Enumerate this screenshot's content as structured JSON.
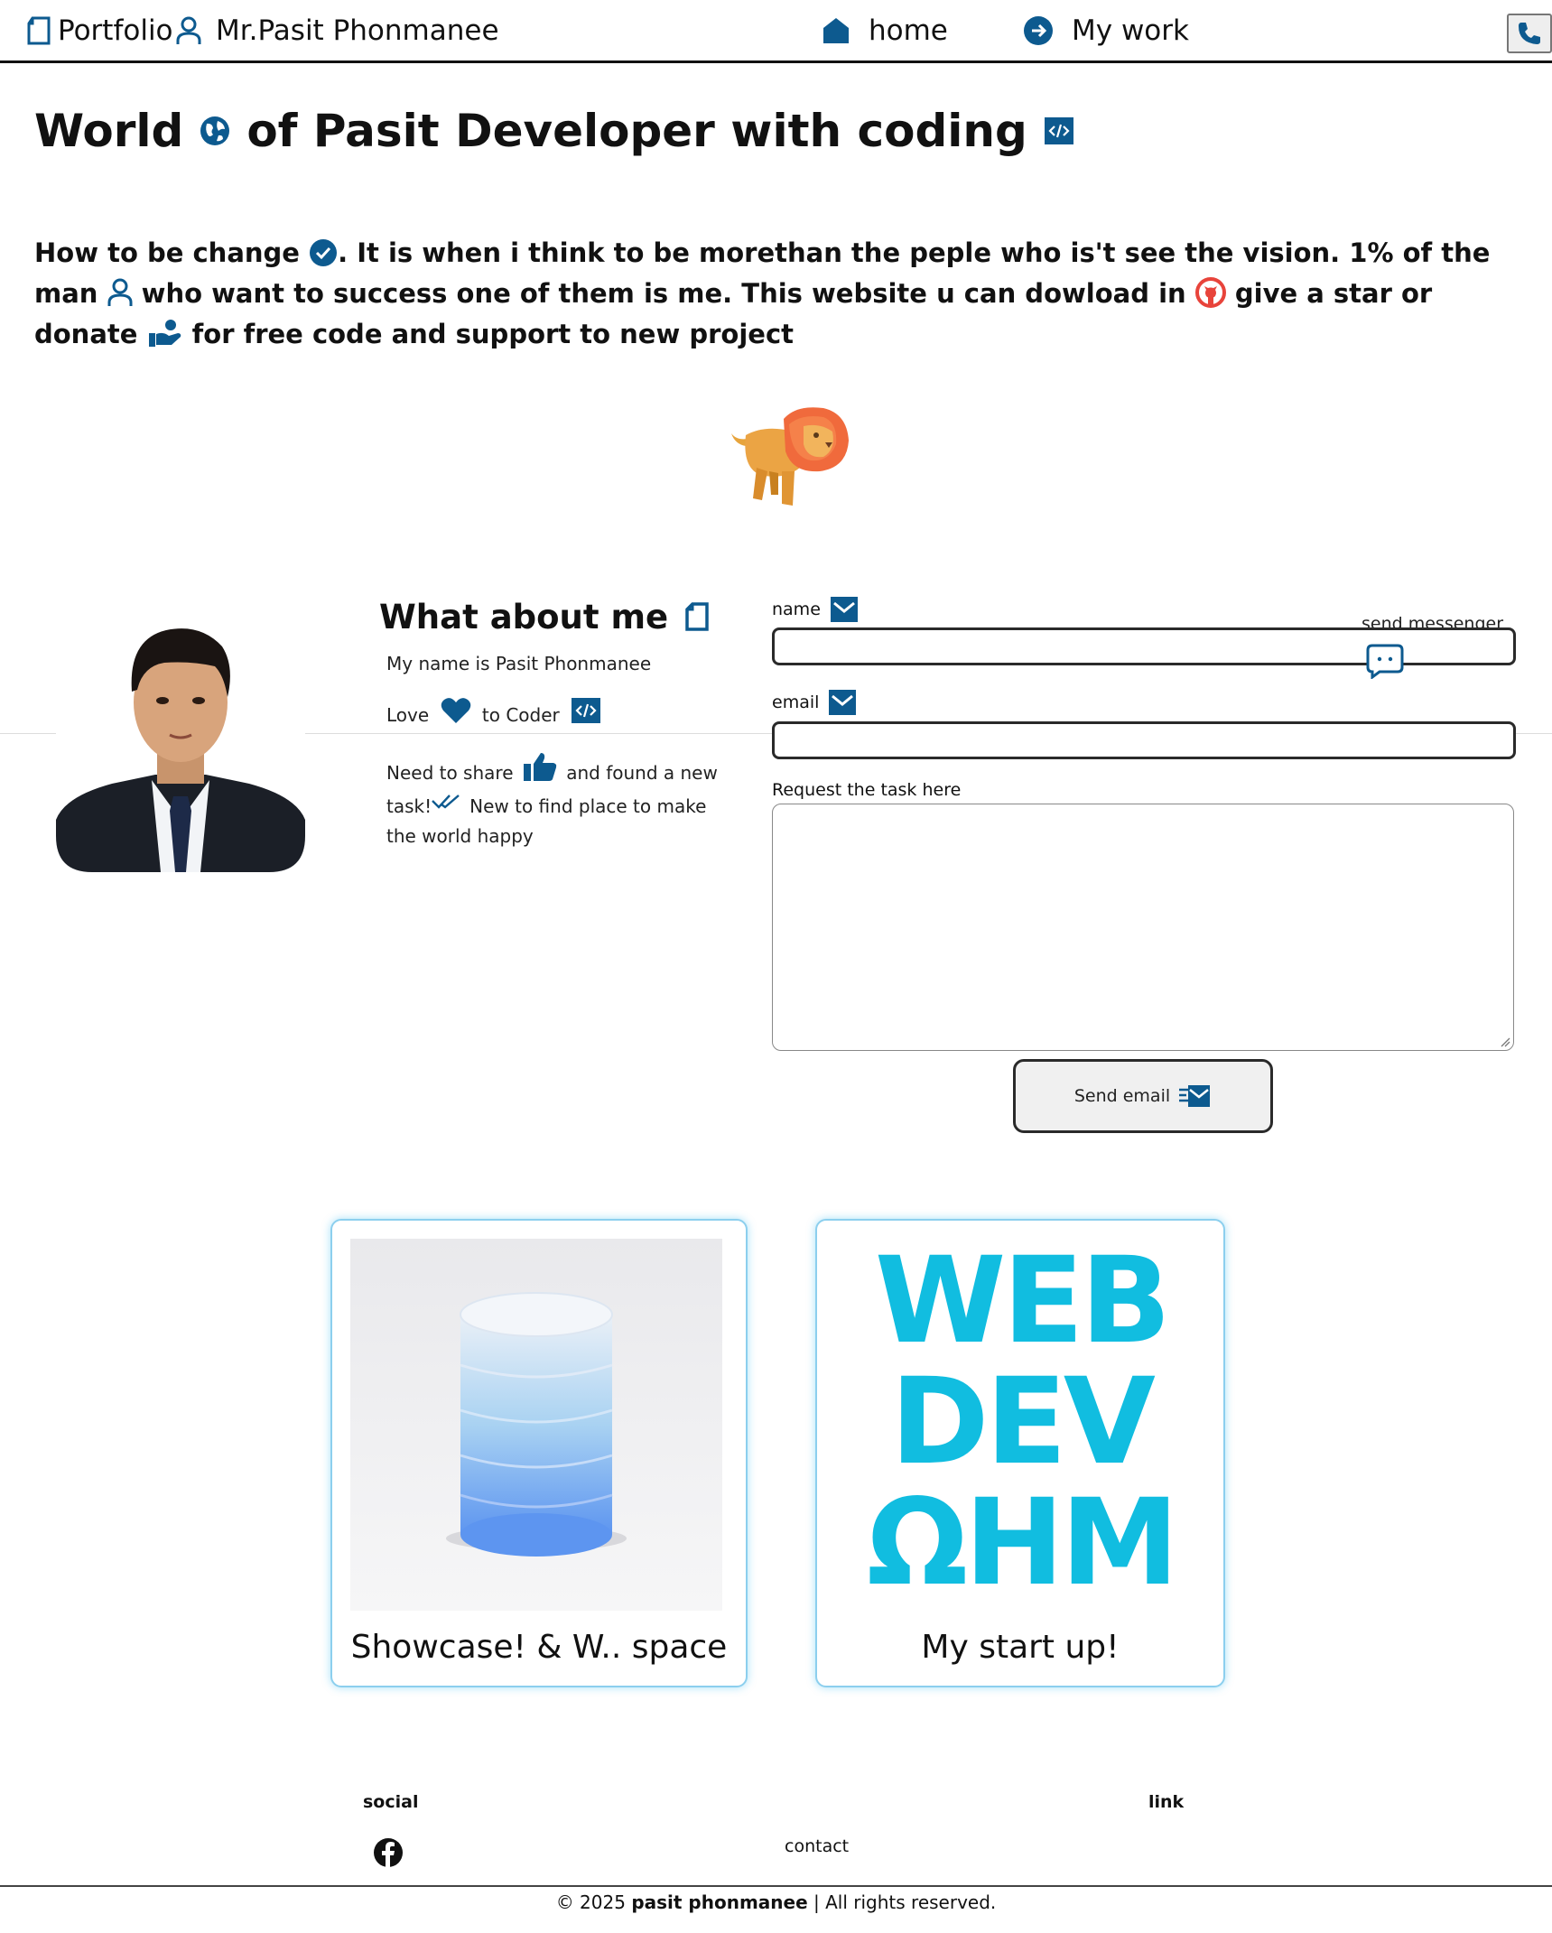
{
  "nav": {
    "brand": "Portfolio",
    "owner": "Mr.Pasit Phonmanee",
    "links": [
      {
        "label": "home",
        "icon": "home-icon"
      },
      {
        "label": "My work",
        "icon": "arrow-right-circle-icon"
      }
    ],
    "phone_icon": "phone-icon"
  },
  "hero": {
    "title_part1": "World",
    "title_part2": "of Pasit Developer with coding",
    "text": {
      "s1": "How to be change",
      "s2": ". It is when i think to be morethan the peple who is't see the vision. 1% of the man",
      "s3": "who want to success one of them is me. This website u can dowload in",
      "s4": "give a star or donate",
      "s5": "for free code and support to new project"
    }
  },
  "about": {
    "title": "What about me",
    "line1": "My name is Pasit Phonmanee",
    "love": "Love",
    "to_coder": "to Coder",
    "share1": "Need to share",
    "share2": "and found a new",
    "task": "task!",
    "task2": "New to find place to make",
    "world": "the world happy"
  },
  "form": {
    "name_label": "name",
    "email_label": "email",
    "request_label": "Request the task here",
    "send_button": "Send email",
    "messenger": "send messenger"
  },
  "cards": [
    {
      "caption": "Showcase! & W.. space"
    },
    {
      "caption": "My start up!",
      "logo_lines": [
        "WEB",
        "DEV",
        "ΩHM"
      ]
    }
  ],
  "footer": {
    "social": "social",
    "link": "link",
    "contact": "contact",
    "copyright_prefix": "© 2025",
    "copyright_name": "pasit phonmanee",
    "copyright_suffix": "| All rights reserved."
  },
  "colors": {
    "accent": "#0d5a8f",
    "logo_cyan": "#11bde0",
    "github_red": "#e8443b",
    "card_glow": "#8ccfee"
  }
}
